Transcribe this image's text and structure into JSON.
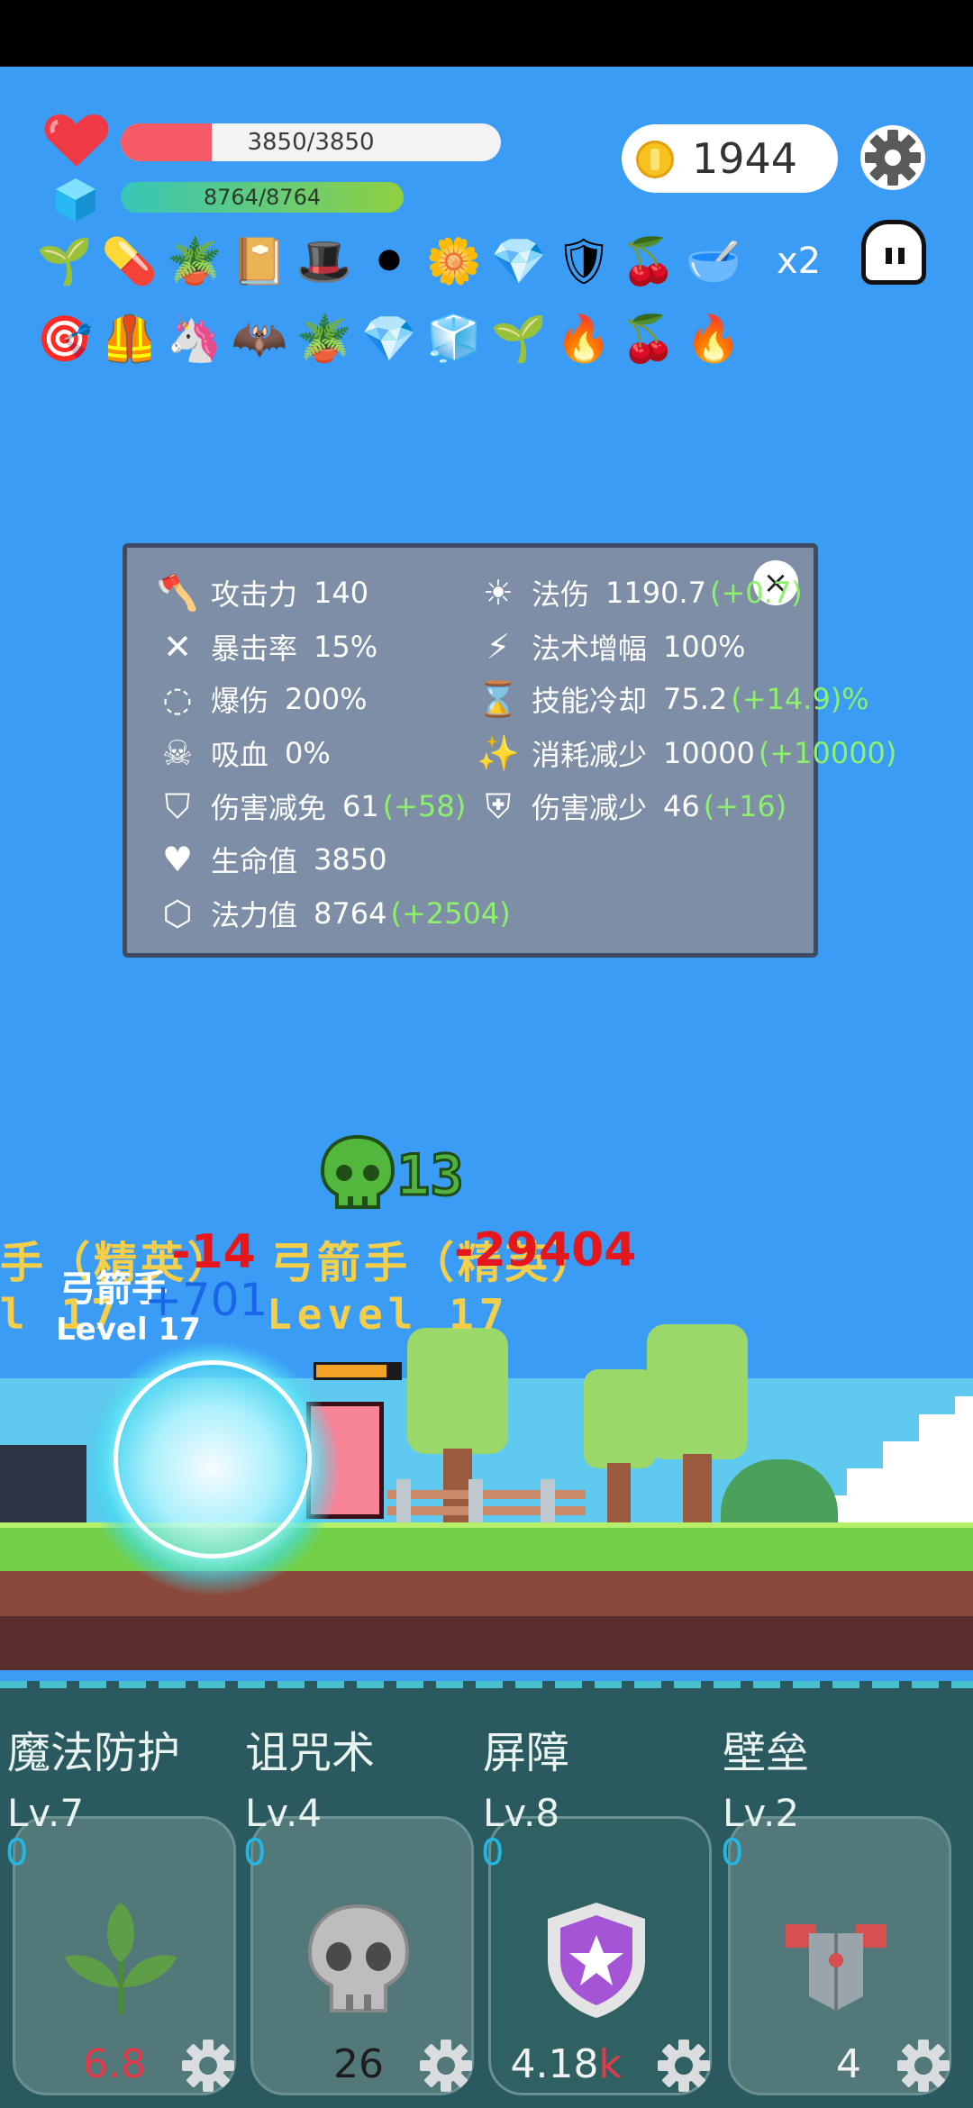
{
  "hud": {
    "hp_text": "3850/3850",
    "hp_fraction": 0.24,
    "mp_text": "8764/8764",
    "mp_fraction": 1.0,
    "coins": "1944",
    "multiplier": "x2",
    "row1_items": [
      "sapling-icon",
      "pill-icon",
      "potted-plant-icon",
      "spellbook-icon",
      "wizard-hat-icon",
      "cauldron-icon",
      "daisy-icon",
      "diamond-icon",
      "shield-icon",
      "cherries-icon",
      "mortar-icon"
    ],
    "row2_items": [
      "target-ring-icon",
      "armor-icon",
      "unicorn-icon",
      "bat-icon",
      "potted-plant-icon",
      "diamond-icon",
      "ice-cubes-icon",
      "sapling-icon",
      "flame-rock-icon",
      "cherries-icon",
      "fire-icon"
    ]
  },
  "stats": {
    "left": [
      {
        "icon": "axe-icon",
        "label": "攻击力",
        "value": "140",
        "bonus": ""
      },
      {
        "icon": "crossed-swords-icon",
        "label": "暴击率",
        "value": "15%",
        "bonus": ""
      },
      {
        "icon": "burst-circle-icon",
        "label": "爆伤",
        "value": "200%",
        "bonus": ""
      },
      {
        "icon": "demon-skull-icon",
        "label": "吸血",
        "value": "0%",
        "bonus": ""
      },
      {
        "icon": "shield-outline-icon",
        "label": "伤害减免",
        "value": "61",
        "bonus": "(+58)"
      },
      {
        "icon": "heart-icon",
        "label": "生命值",
        "value": "3850",
        "bonus": ""
      },
      {
        "icon": "hexagon-gem-icon",
        "label": "法力值",
        "value": "8764",
        "bonus": "(+2504)"
      }
    ],
    "right": [
      {
        "icon": "sun-icon",
        "label": "法伤",
        "value": "1190.7",
        "bonus": "(+0.7)"
      },
      {
        "icon": "lightning-icon",
        "label": "法术增幅",
        "value": "100%",
        "bonus": ""
      },
      {
        "icon": "hourglass-icon",
        "label": "技能冷却",
        "value": "75.2",
        "bonus": "(+14.9)%"
      },
      {
        "icon": "magic-wand-icon",
        "label": "消耗减少",
        "value": "10000",
        "bonus": "(+10000)"
      },
      {
        "icon": "shield-heart-icon",
        "label": "伤害减少",
        "value": "46",
        "bonus": "(+16)"
      }
    ],
    "close": "×"
  },
  "combat": {
    "skull_count": "13",
    "enemy_name_left": "手（精英）",
    "enemy_name_right": "弓箭手（精英）",
    "enemy_level_left": "l 17",
    "enemy_level_right": "Level 17",
    "dmg_red_1": "-14",
    "dmg_red_2": "-29404",
    "dmg_blue": "+701",
    "player_name": "弓箭手",
    "player_level": "Level 17",
    "enemy_hp_fraction": 0.85
  },
  "skills": [
    {
      "name": "魔法防护",
      "level": "Lv.7",
      "count": "0",
      "cost": "6.8",
      "cost_unit": "",
      "icon": "leaf-icon"
    },
    {
      "name": "诅咒术",
      "level": "Lv.4",
      "count": "0",
      "cost": "26",
      "cost_unit": "",
      "icon": "skull-icon"
    },
    {
      "name": "屏障",
      "level": "Lv.8",
      "count": "0",
      "cost": "4.18",
      "cost_unit": "k",
      "icon": "star-shield-icon"
    },
    {
      "name": "壁垒",
      "level": "Lv.2",
      "count": "0",
      "cost": "4",
      "cost_unit": "",
      "icon": "chest-armor-icon"
    }
  ]
}
